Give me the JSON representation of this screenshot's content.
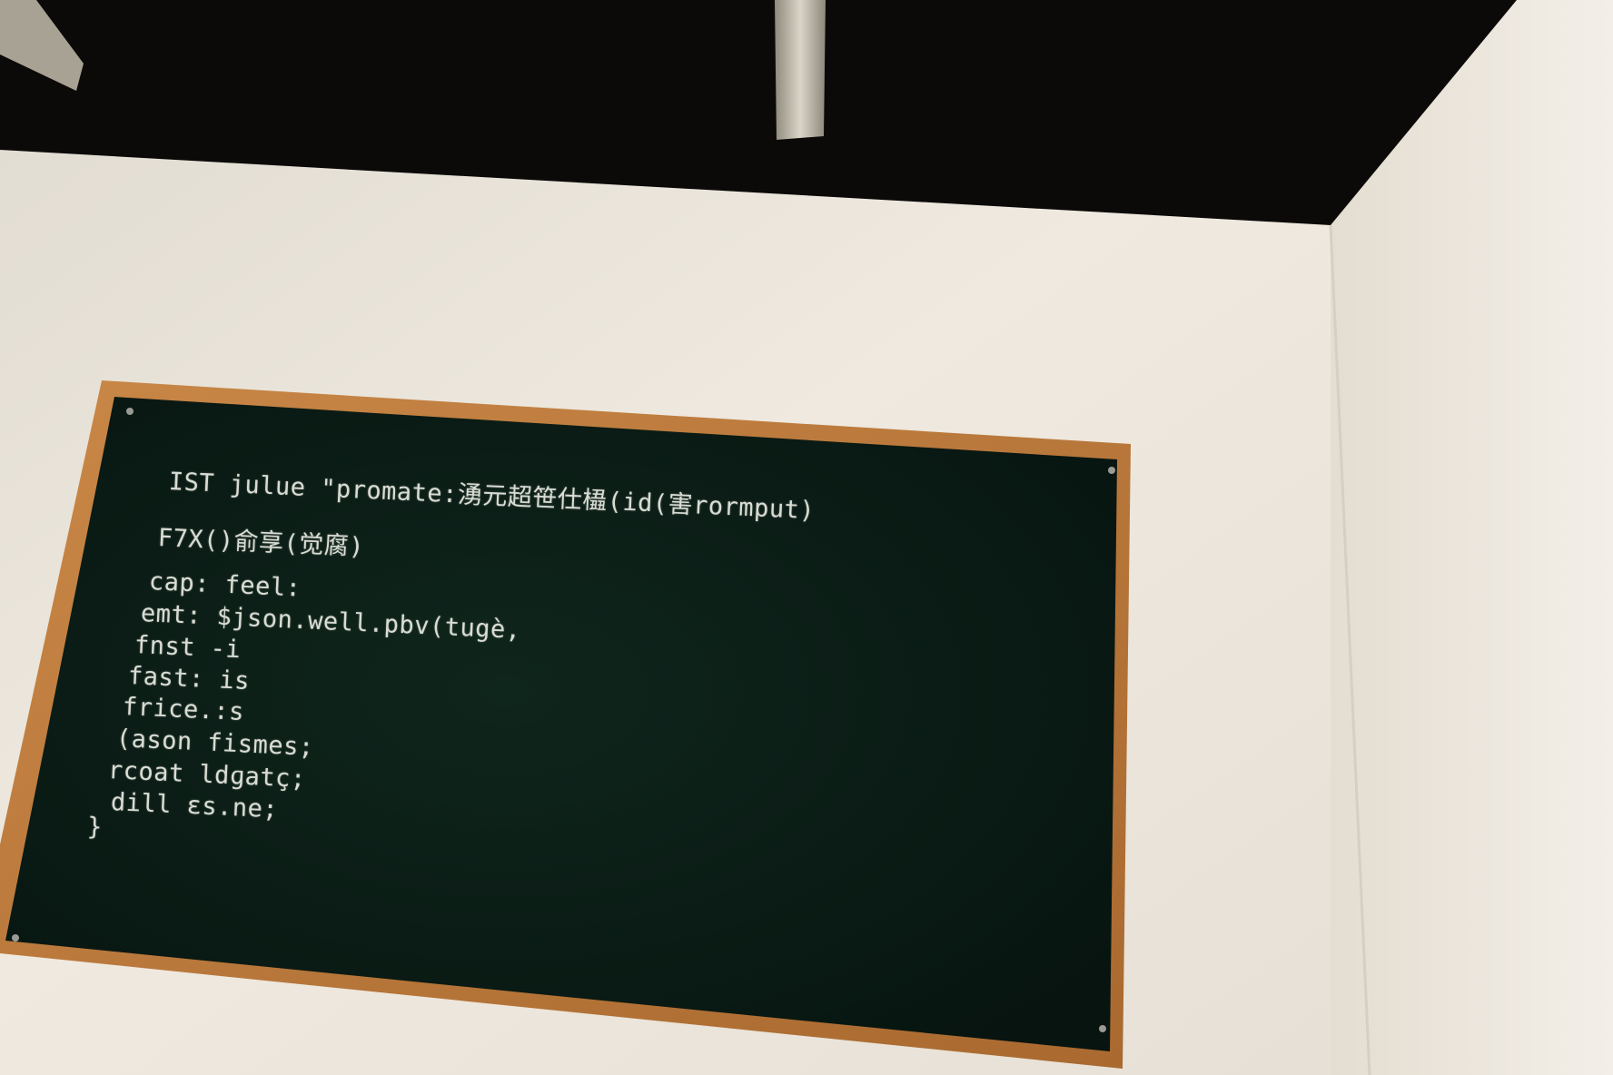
{
  "chalkboard": {
    "lines": [
      "IST julue \"promate:湧元超笹仕橻(id(害rormput)",
      "F7X()俞享(觉腐)",
      "cap: feel:",
      "emt: $json.well.pbv(tugè,",
      "fnst -i",
      "fast: is",
      "frice.:s",
      "(ason fismes;",
      "rcoat ldɡatç;",
      "dill εs.ne;",
      "}"
    ]
  },
  "colors": {
    "ceiling": "#0b0a09",
    "wall": "#ece6dc",
    "board": "#0e2219",
    "frame": "#b9773e",
    "chalk": "#d9dcd4"
  }
}
